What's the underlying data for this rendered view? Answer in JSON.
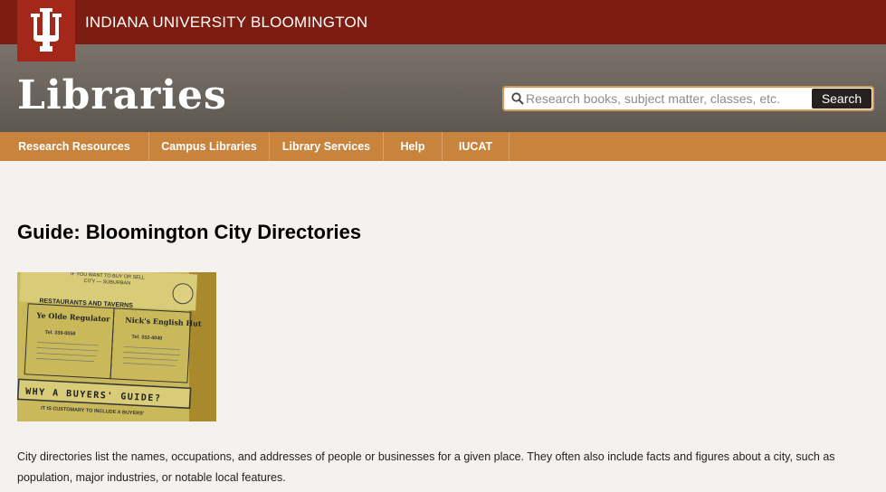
{
  "header": {
    "university": "INDIANA UNIVERSITY BLOOMINGTON",
    "site_title": "Libraries"
  },
  "search": {
    "placeholder": "Research books, subject matter, classes, etc.",
    "button_label": "Search"
  },
  "nav": {
    "items": [
      {
        "label": "Research Resources"
      },
      {
        "label": "Campus Libraries"
      },
      {
        "label": "Library Services"
      },
      {
        "label": "Help"
      },
      {
        "label": "IUCAT"
      }
    ]
  },
  "main": {
    "title": "Guide: Bloomington City Directories",
    "intro": "City directories list the names, occupations, and addresses of people or businesses for a given place. They often also include facts and figures about a city, such as population, major industries, or notable local features.",
    "photo": {
      "line1": "IF YOU WANT TO BUY OR SELL",
      "line2": "CITY — SUBURBAN",
      "heading": "RESTAURANTS AND TAVERNS",
      "ad1_name": "Ye Olde Regulator",
      "ad1_phone": "Tel. 339-0058",
      "ad2_name": "Nick's English Hut",
      "ad2_phone": "Tel. 332-4040",
      "banner": "WHY A BUYERS' GUIDE?",
      "footer": "IT IS CUSTOMARY TO INCLUDE A BUYERS'"
    }
  },
  "colors": {
    "topbar": "#7d1d12",
    "trident_block": "#a3281a",
    "nav": "#c8843c",
    "band": "#6b645e",
    "page_bg": "#f5f1ee"
  }
}
